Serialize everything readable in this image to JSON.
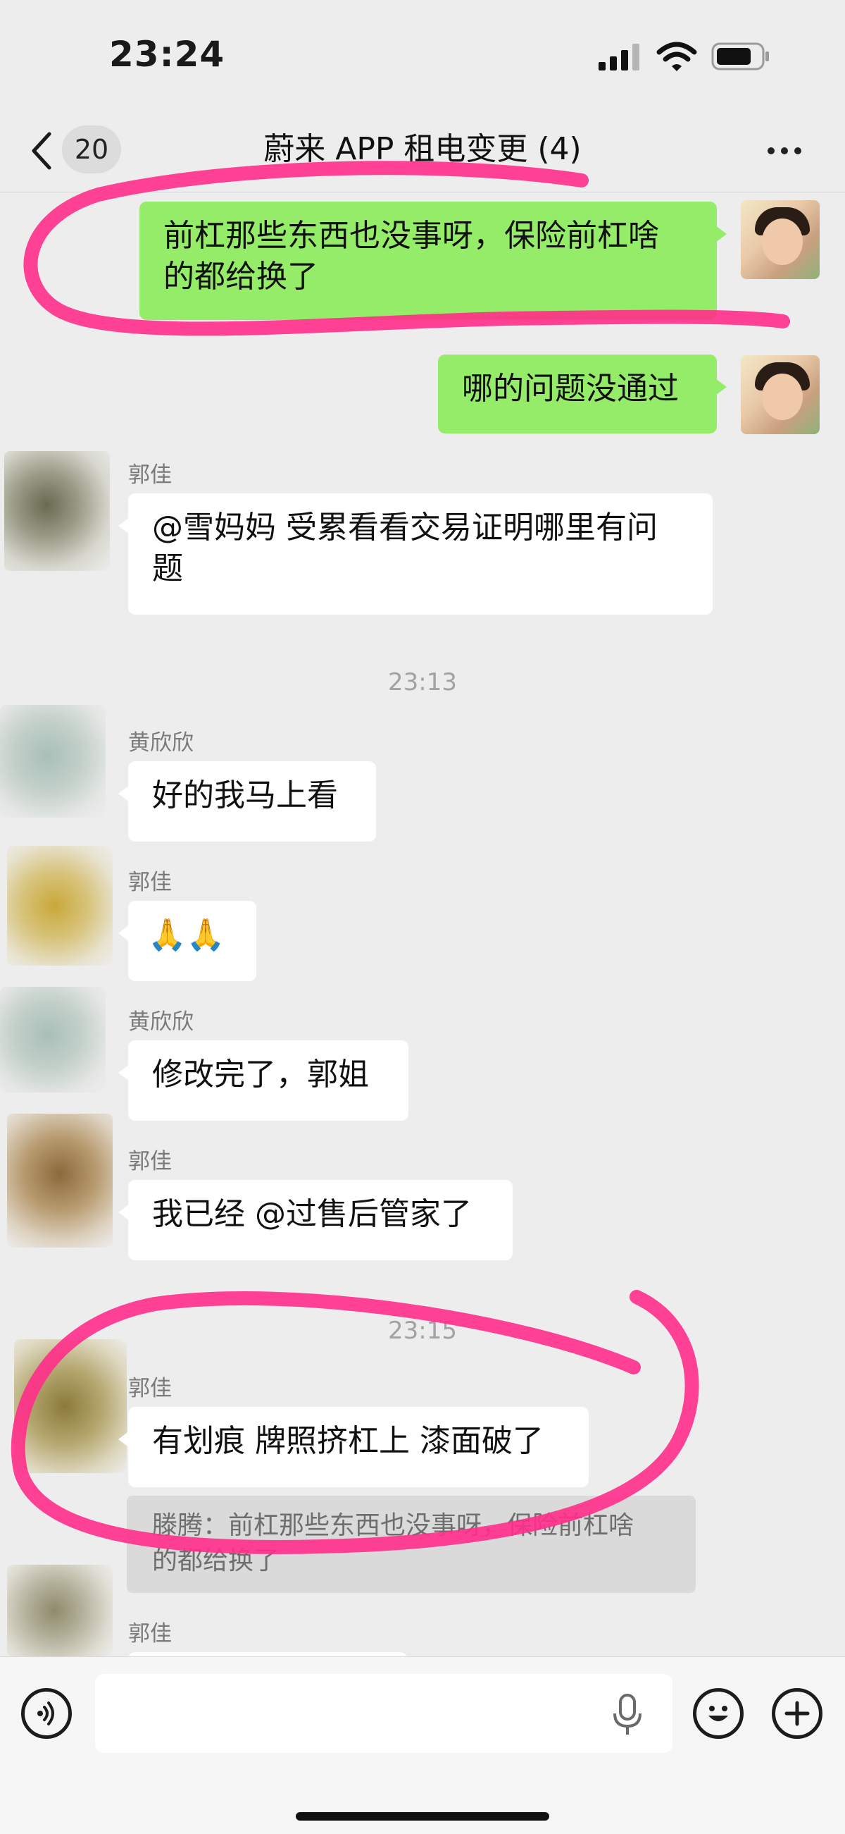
{
  "status_bar": {
    "time": "23:24"
  },
  "nav": {
    "back_count": "20",
    "title": "蔚来 APP 租电变更 (4)"
  },
  "messages": [
    {
      "side": "me",
      "text_line1": "前杠那些东西也没事呀，保险前杠啥",
      "text_line2": "的都给换了"
    },
    {
      "side": "me",
      "text": "哪的问题没通过"
    },
    {
      "side": "them",
      "sender": "郭佳",
      "text_line1": "@雪妈妈 受累看看交易证明哪里有问",
      "text_line2": "题"
    },
    {
      "side": "them",
      "sender": "黄欣欣",
      "text": "好的我马上看"
    },
    {
      "side": "them",
      "sender": "郭佳",
      "text": "🙏🙏"
    },
    {
      "side": "them",
      "sender": "黄欣欣",
      "text": "修改完了，郭姐"
    },
    {
      "side": "them",
      "sender": "郭佳",
      "text": "我已经 @过售后管家了"
    },
    {
      "side": "them",
      "sender": "郭佳",
      "text": "有划痕 牌照挤杠上 漆面破了",
      "quote_line1": "滕腾：前杠那些东西也没事呀，保险前杠啥",
      "quote_line2": "的都给换了"
    },
    {
      "side": "them",
      "sender": "郭佳"
    }
  ],
  "timestamps": [
    "23:13",
    "23:15"
  ],
  "colors": {
    "my_bubble": "#95ec69",
    "their_bubble": "#ffffff",
    "background": "#ededed",
    "annotation": "#ff2d8a"
  },
  "icons": [
    "back-chevron-icon",
    "more-icon",
    "voice-icon",
    "mic-icon",
    "emoji-icon",
    "plus-icon"
  ]
}
